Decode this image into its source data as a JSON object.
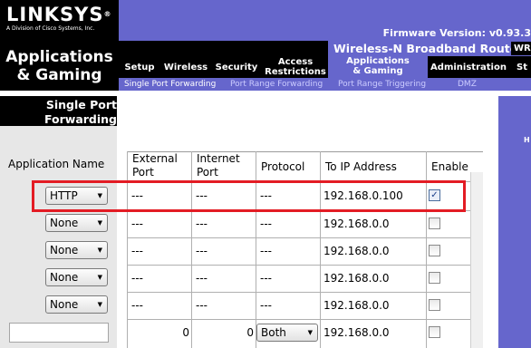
{
  "header": {
    "logo": "LINKSYS",
    "logo_reg": "®",
    "logo_sub": "A Division of Cisco Systems, Inc.",
    "firmware": "Firmware Version: v0.93.3",
    "router_name": "Wireless-N Broadband Router",
    "router_model": "WR"
  },
  "section": {
    "title_line1": "Applications",
    "title_line2": "& Gaming"
  },
  "tabs": {
    "setup": "Setup",
    "wireless": "Wireless",
    "security": "Security",
    "access_line1": "Access",
    "access_line2": "Restrictions",
    "apps_line1": "Applications",
    "apps_line2": "& Gaming",
    "administration": "Administration",
    "status": "St"
  },
  "subtabs": [
    "Single Port Forwarding",
    "Port Range Forwarding",
    "Port Range Triggering",
    "DMZ"
  ],
  "left": {
    "heading_line1": "Single Port",
    "heading_line2": "Forwarding",
    "app_name_label": "Application Name"
  },
  "right": {
    "help": "H"
  },
  "table": {
    "headers": {
      "external_line1": "External",
      "external_line2": "Port",
      "internal_line1": "Internet",
      "internal_line2": "Port",
      "protocol": "Protocol",
      "ip": "To IP Address",
      "enable": "Enable"
    },
    "rows": [
      {
        "app": "HTTP",
        "ext": "---",
        "int": "---",
        "proto": "---",
        "ip": "192.168.0.100",
        "enabled": true
      },
      {
        "app": "None",
        "ext": "---",
        "int": "---",
        "proto": "---",
        "ip": "192.168.0.0",
        "enabled": false
      },
      {
        "app": "None",
        "ext": "---",
        "int": "---",
        "proto": "---",
        "ip": "192.168.0.0",
        "enabled": false
      },
      {
        "app": "None",
        "ext": "---",
        "int": "---",
        "proto": "---",
        "ip": "192.168.0.0",
        "enabled": false
      },
      {
        "app": "None",
        "ext": "---",
        "int": "---",
        "proto": "---",
        "ip": "192.168.0.0",
        "enabled": false
      },
      {
        "app": "",
        "ext": "0",
        "int": "0",
        "proto": "Both",
        "ip": "192.168.0.0",
        "enabled": false
      }
    ],
    "dropdown_arrow": "▼",
    "check_mark": "✓"
  },
  "colors": {
    "purple": "#6666cc",
    "black": "#000000",
    "highlight": "#e31c24"
  }
}
